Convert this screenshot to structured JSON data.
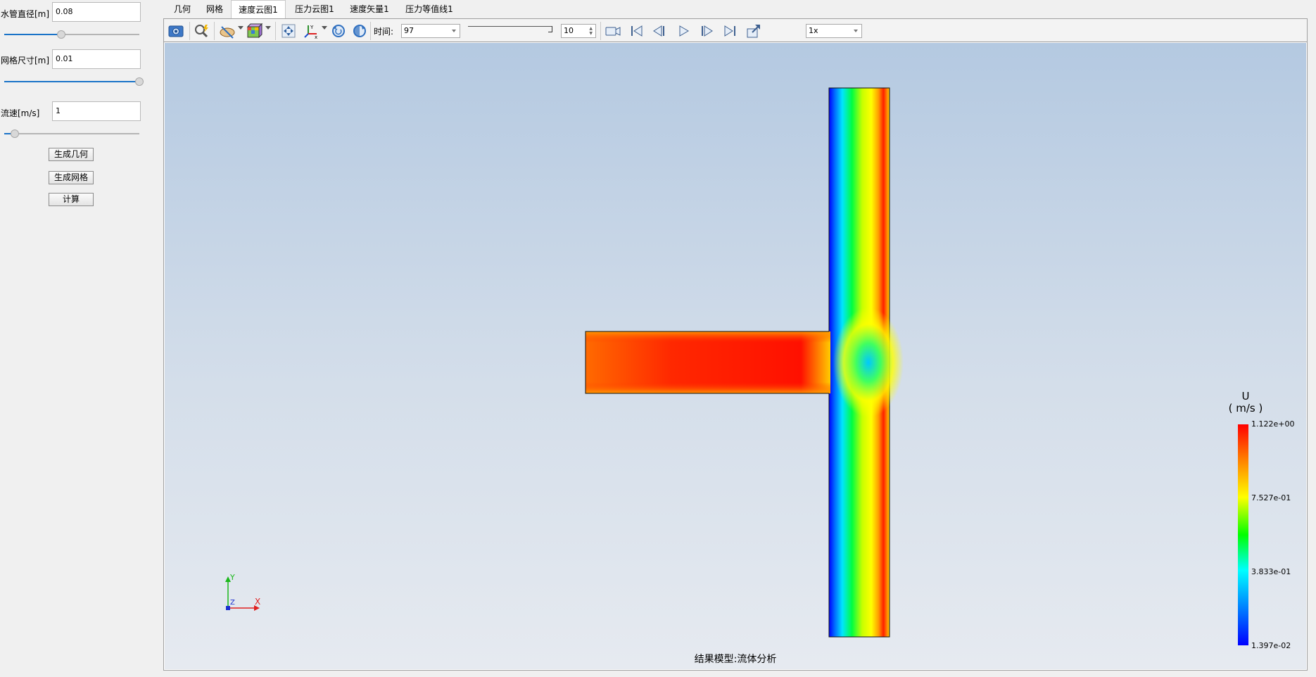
{
  "left_panel": {
    "pipe_diameter": {
      "label": "水管直径[m]",
      "value": "0.08",
      "slider_fraction": 0.42
    },
    "mesh_size": {
      "label": "网格尺寸[m]",
      "value": "0.01",
      "slider_fraction": 1.0
    },
    "flow_velocity": {
      "label": "流速[m/s]",
      "value": "1",
      "slider_fraction": 0.08
    },
    "buttons": {
      "generate_geometry": "生成几何",
      "generate_mesh": "生成网格",
      "compute": "计算"
    }
  },
  "tabs": [
    {
      "label": "几何",
      "active": false
    },
    {
      "label": "网格",
      "active": false
    },
    {
      "label": "速度云图1",
      "active": true
    },
    {
      "label": "压力云图1",
      "active": false
    },
    {
      "label": "速度矢量1",
      "active": false
    },
    {
      "label": "压力等值线1",
      "active": false
    }
  ],
  "toolbar": {
    "time_label": "时间:",
    "time_value": "97",
    "step_value": "10",
    "speed_value": "1x"
  },
  "viewport": {
    "caption": "结果模型:流体分析",
    "axes": {
      "x": "X",
      "y": "Y",
      "z": "Z"
    },
    "legend": {
      "variable": "U",
      "unit": "( m/s )",
      "max": "1.122e+00",
      "mid_high": "7.527e-01",
      "mid_low": "3.833e-01",
      "min": "1.397e-02"
    }
  },
  "colors": {
    "accent": "#1a73c8",
    "viewport_top": "#b4c9e1",
    "viewport_bottom": "#e6eaf0",
    "high_velocity": "#ff0000",
    "low_velocity": "#0000ff"
  }
}
